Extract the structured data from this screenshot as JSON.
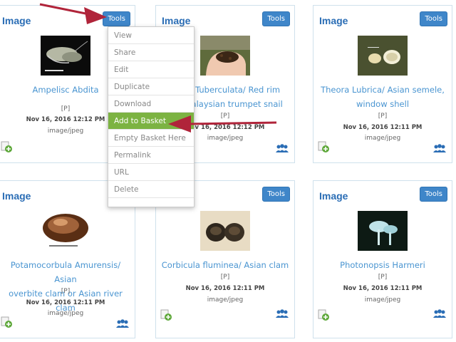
{
  "cards": [
    {
      "header": "Image",
      "tools": "Tools",
      "title": "Ampelisc Abdita",
      "title2": "",
      "p": "[P]",
      "date": "Nov 16, 2016 12:12 PM",
      "mime": "image/jpeg"
    },
    {
      "header": "Image",
      "tools": "Tools",
      "title": "ides Tuberculata/ Red rim",
      "title2": "or Malaysian trumpet snail",
      "p": "[P]",
      "date": "Nov 16, 2016 12:12 PM",
      "mime": "image/jpeg"
    },
    {
      "header": "Image",
      "tools": "Tools",
      "title": "Theora Lubrica/ Asian semele,",
      "title2": "window shell",
      "p": "[P]",
      "date": "Nov 16, 2016 12:11 PM",
      "mime": "image/jpeg"
    },
    {
      "header": "Image",
      "tools": "Tools",
      "title": "Potamocorbula Amurensis/ Asian",
      "title2": "overbite clam or Asian river clam",
      "p": "[P]",
      "date": "Nov 16, 2016 12:11 PM",
      "mime": "image/jpeg"
    },
    {
      "header": "Image",
      "tools": "Tools",
      "title": "Corbicula fluminea/ Asian clam",
      "title2": "",
      "p": "[P]",
      "date": "Nov 16, 2016 12:11 PM",
      "mime": "image/jpeg"
    },
    {
      "header": "Image",
      "tools": "Tools",
      "title": "Photonopsis Harmeri",
      "title2": "",
      "p": "[P]",
      "date": "Nov 16, 2016 12:11 PM",
      "mime": "image/jpeg"
    }
  ],
  "menu": [
    "View",
    "Share",
    "Edit",
    "Duplicate",
    "Download",
    "Add to Basket",
    "Empty Basket Here",
    "Permalink",
    "URL",
    "Delete"
  ],
  "menu_active_index": 5,
  "colors": {
    "accent": "#3f86c9",
    "menu_active": "#7cb342",
    "arrow": "#b0243a",
    "title_link": "#4a95d1"
  }
}
